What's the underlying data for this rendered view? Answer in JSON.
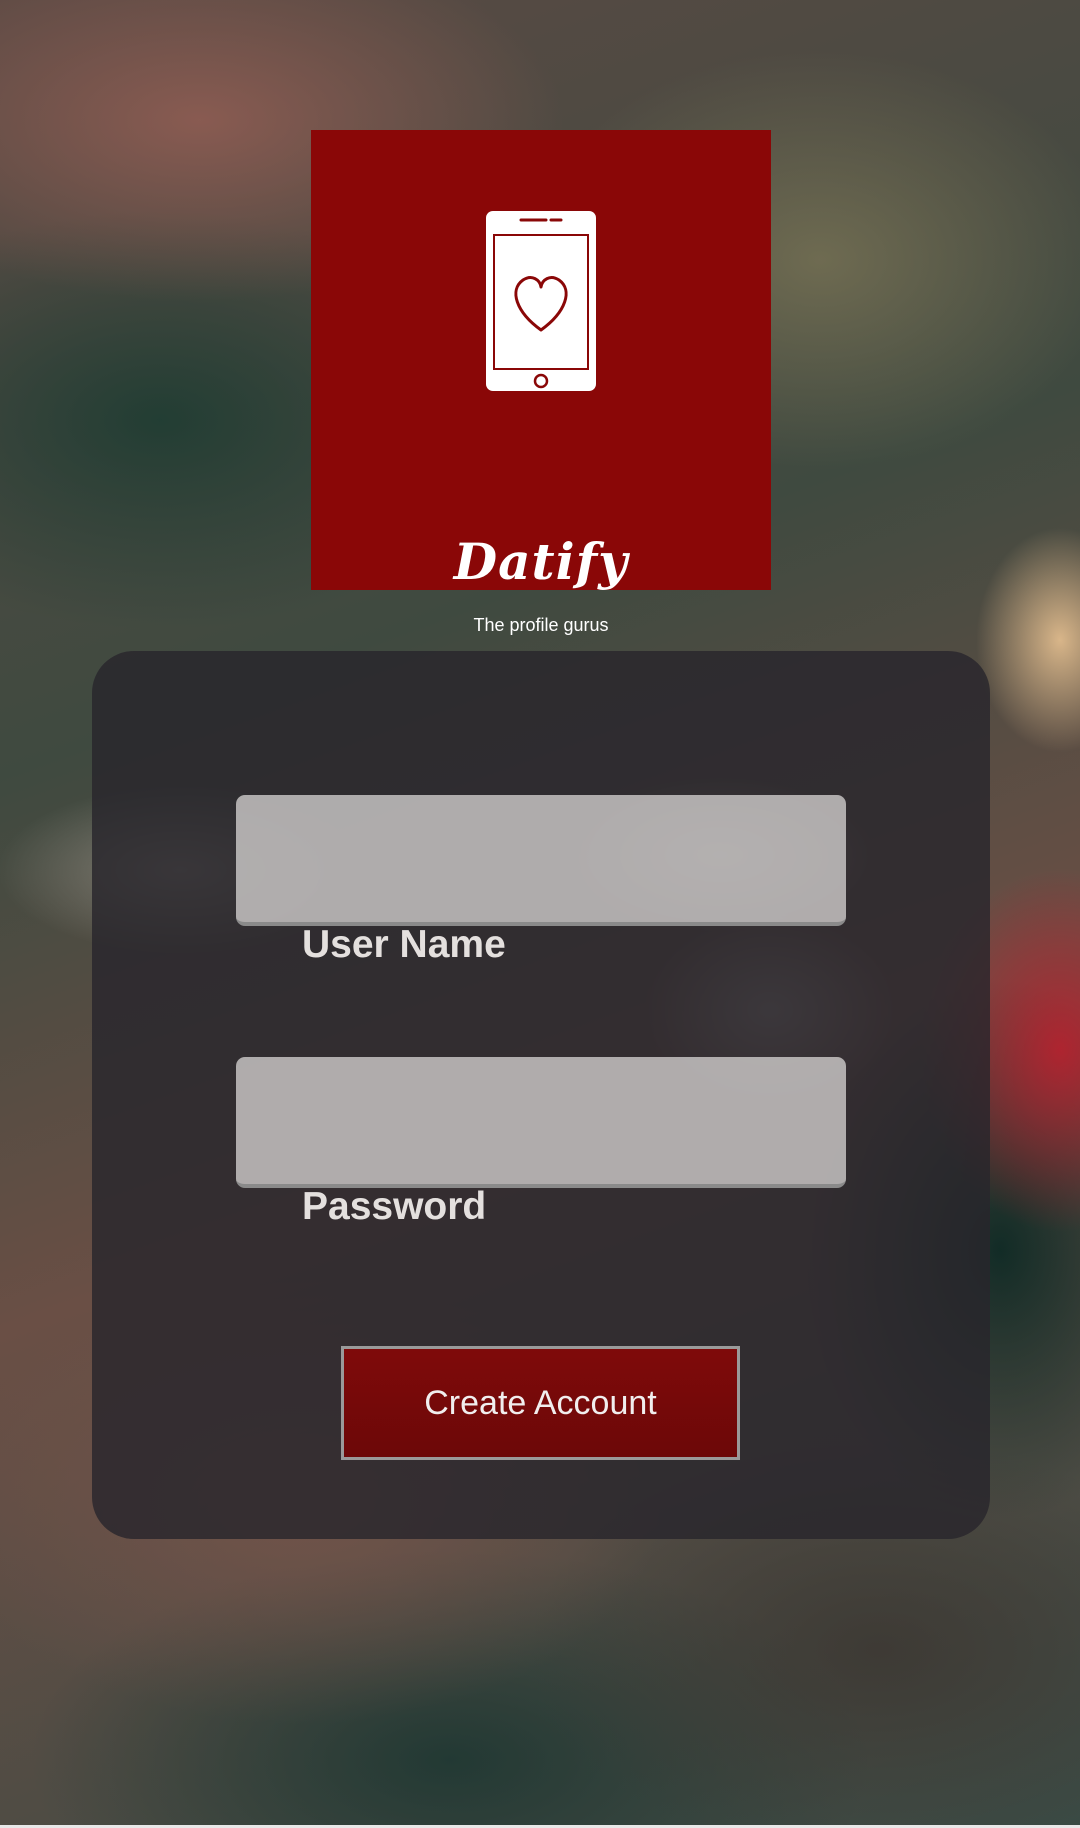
{
  "logo": {
    "title": "Datify",
    "tagline": "The profile gurus",
    "icon": "phone-heart-icon",
    "background_color": "#8a0707"
  },
  "form": {
    "username_label": "User Name",
    "username_value": "",
    "password_label": "Password",
    "password_value": "",
    "submit_label": "Create Account",
    "button_color": "#7a0909"
  }
}
